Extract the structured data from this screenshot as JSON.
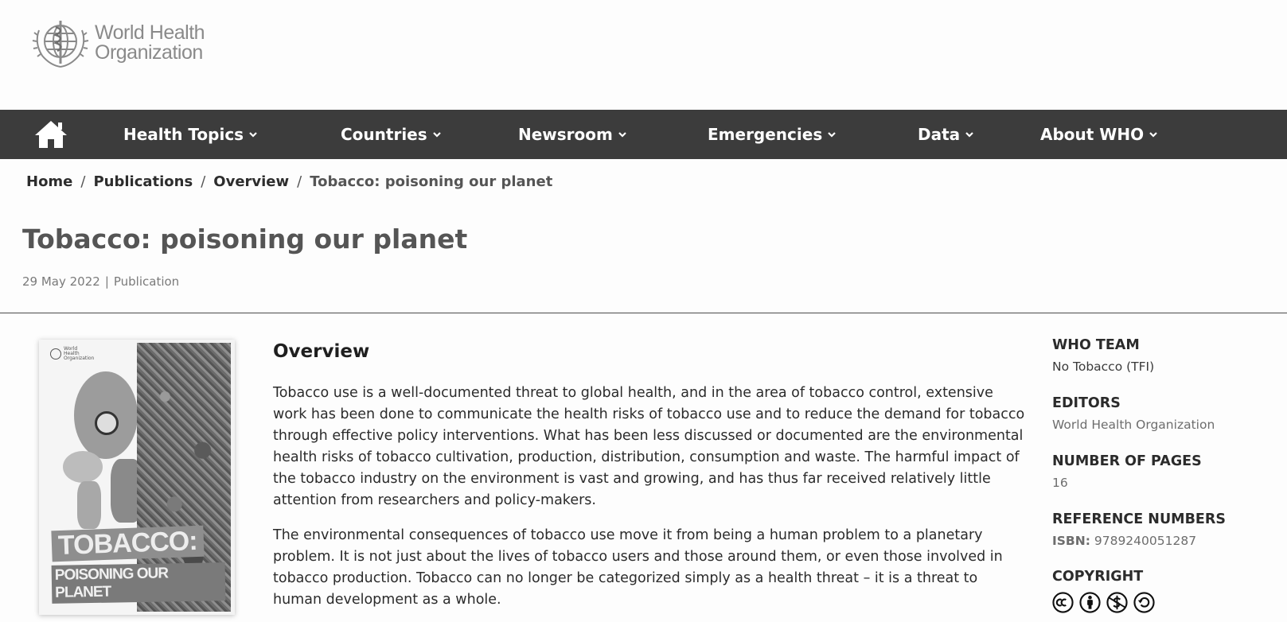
{
  "header": {
    "logo_line1": "World Health",
    "logo_line2": "Organization"
  },
  "nav": {
    "home_icon": "home-icon",
    "items": [
      {
        "label": "Health Topics"
      },
      {
        "label": "Countries"
      },
      {
        "label": "Newsroom"
      },
      {
        "label": "Emergencies"
      },
      {
        "label": "Data"
      },
      {
        "label": "About WHO"
      }
    ]
  },
  "breadcrumb": {
    "items": [
      "Home",
      "Publications",
      "Overview"
    ],
    "separator": "/",
    "current": "Tobacco: poisoning our planet"
  },
  "page": {
    "title": "Tobacco: poisoning our planet",
    "date": "29 May 2022",
    "type": "Publication"
  },
  "cover": {
    "title_line1": "TOBACCO:",
    "title_line2": "POISONING OUR PLANET",
    "logo_text": "World Health Organization"
  },
  "overview": {
    "heading": "Overview",
    "paragraphs": [
      "Tobacco use is a well-documented threat to global health, and in the area of tobacco control, extensive work has been done to communicate the health risks of tobacco use and to reduce the demand for tobacco through effective policy interventions. What has been less discussed or documented are the environmental health risks of tobacco cultivation, production, distribution, consumption and waste. The harmful impact of the tobacco industry on the environment is vast and growing, and has thus far received relatively little attention from researchers and policy-makers.",
      "The environmental consequences of tobacco use move it from being a human problem to a planetary problem. It is not just about the lives of tobacco users and those around them, or even those involved in tobacco production. Tobacco can no longer be categorized simply as a health threat – it is a threat to human development as a whole."
    ]
  },
  "details": {
    "who_team_label": "WHO TEAM",
    "who_team_value": "No Tobacco (TFI)",
    "editors_label": "EDITORS",
    "editors_value": "World Health Organization",
    "pages_label": "NUMBER OF PAGES",
    "pages_value": "16",
    "ref_label": "REFERENCE NUMBERS",
    "isbn_label": "ISBN:",
    "isbn_value": "9789240051287",
    "copyright_label": "COPYRIGHT",
    "copyright_icons": [
      "cc-icon",
      "by-attribution-icon",
      "noncommercial-icon",
      "sharealike-icon"
    ]
  },
  "colors": {
    "nav_bg": "#3c3c3c",
    "page_bg": "#fdfdfd",
    "title_gray": "#555555"
  }
}
